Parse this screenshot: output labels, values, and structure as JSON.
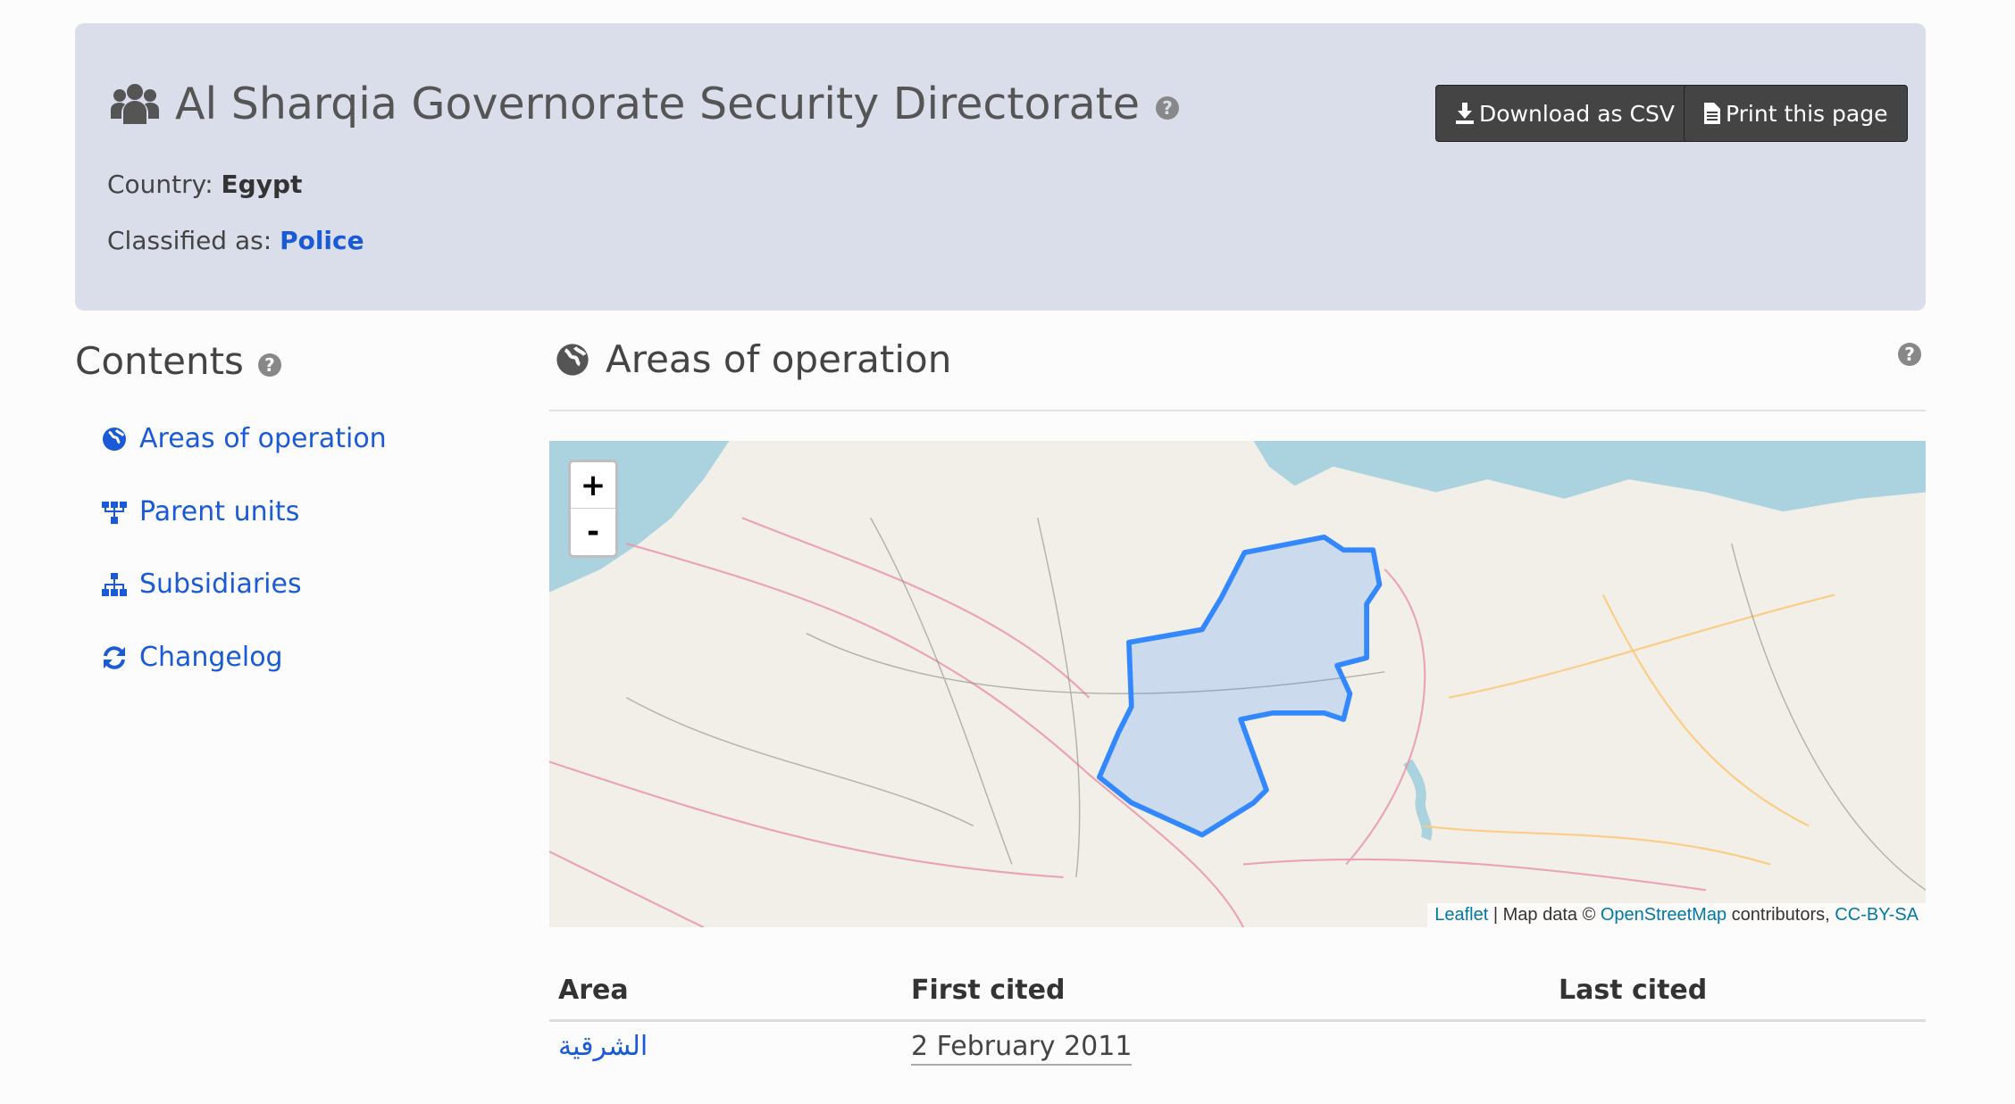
{
  "header": {
    "title": "Al Sharqia Governorate Security Directorate",
    "title_icon": "users-icon",
    "help": "?",
    "download_label": "Download as CSV",
    "print_label": "Print this page",
    "country_label": "Country:",
    "country": "Egypt",
    "classified_label": "Classified as:",
    "classification": "Police"
  },
  "contents": {
    "title": "Contents",
    "help": "?",
    "items": [
      {
        "label": "Areas of operation",
        "icon": "globe-icon"
      },
      {
        "label": "Parent units",
        "icon": "sitemap-up-icon"
      },
      {
        "label": "Subsidiaries",
        "icon": "sitemap-icon"
      },
      {
        "label": "Changelog",
        "icon": "refresh-icon"
      }
    ]
  },
  "areas": {
    "title": "Areas of operation",
    "help": "?",
    "map": {
      "zoom_in": "+",
      "zoom_out": "-",
      "attribution": {
        "leaflet": "Leaflet",
        "map_data": "| Map data ©",
        "osm": "OpenStreetMap",
        "contributors": "contributors,",
        "license": "CC-BY-SA"
      },
      "polygon_color": "#3388ff"
    },
    "table": {
      "headers": [
        "Area",
        "First cited",
        "Last cited"
      ],
      "rows": [
        {
          "area": "الشرقية",
          "first_cited": "2 February 2011",
          "last_cited": ""
        }
      ]
    }
  },
  "colors": {
    "header_bg": "#dadeea",
    "link": "#1a5ad6",
    "button_bg": "#444444"
  }
}
